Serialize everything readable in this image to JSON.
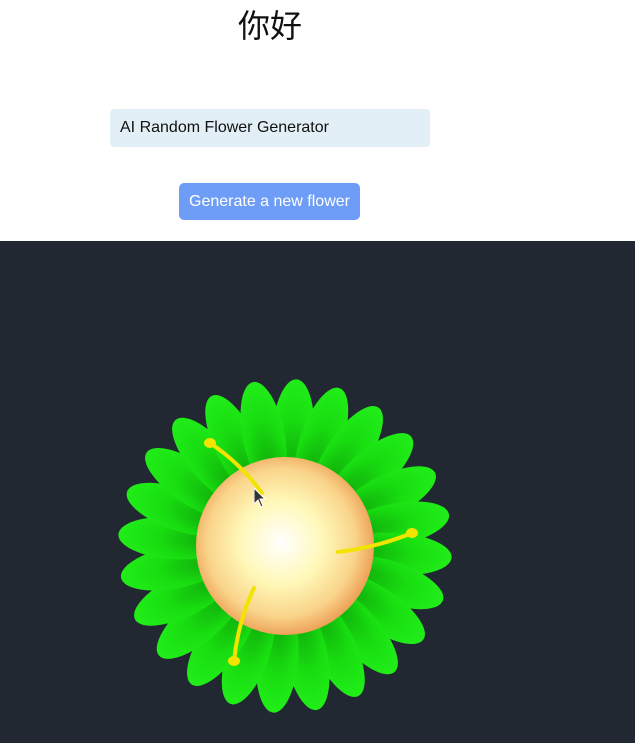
{
  "header": {
    "greeting": "你好",
    "title": "AI Random Flower Generator",
    "generate_button_label": "Generate a new flower"
  },
  "flower": {
    "petal_count": 24,
    "petal_color": "#18dc10",
    "center_color_inner": "#fffde8",
    "center_color_outer": "#f3b46a",
    "stamen_color": "#f2e400",
    "stamen_count": 3
  },
  "colors": {
    "canvas_background": "#222832",
    "button_background": "#6d9df7",
    "title_background": "#e3eff6"
  },
  "icons": {
    "cursor": "mouse-pointer-icon"
  }
}
